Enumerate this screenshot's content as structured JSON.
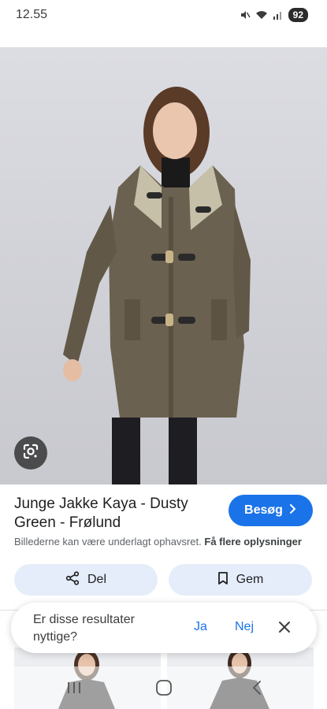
{
  "status_bar": {
    "time": "12.55",
    "battery": "92",
    "icons": [
      "mute-icon",
      "wifi-icon",
      "signal-icon",
      "battery-icon"
    ]
  },
  "image": {
    "subject": "photo",
    "lens_icon": "google-lens-icon"
  },
  "result": {
    "title": "Junge Jakke Kaya - Dusty Green - Frølund",
    "visit_label": "Besøg",
    "copyright_text": "Billederne kan være underlagt ophavsret.",
    "more_info_label": "Få flere oplysninger"
  },
  "actions": {
    "share_label": "Del",
    "save_label": "Gem"
  },
  "feedback": {
    "question": "Er disse resultater nyttige?",
    "yes_label": "Ja",
    "no_label": "Nej"
  },
  "colors": {
    "accent": "#1a73e8",
    "action_bg": "#e5edfa"
  }
}
